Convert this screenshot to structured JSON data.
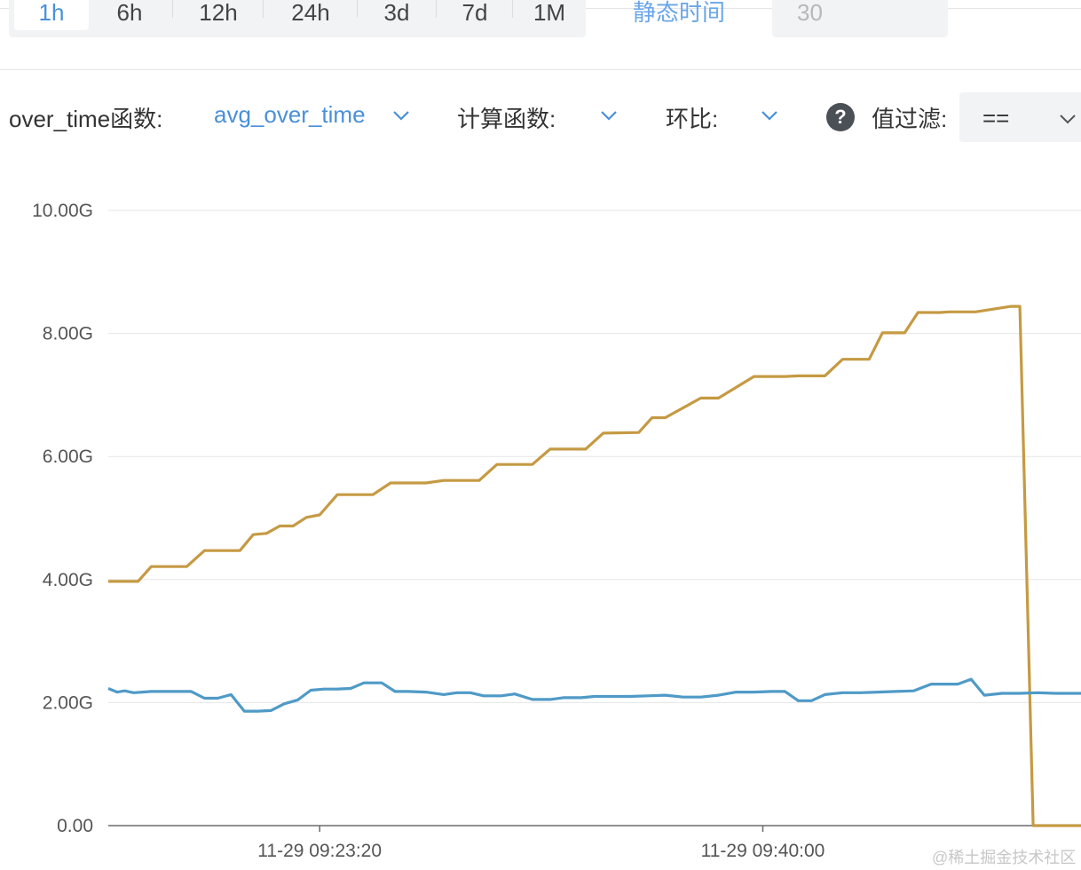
{
  "time_tabs": [
    {
      "label": "1h",
      "active": true
    },
    {
      "label": "6h",
      "active": false
    },
    {
      "label": "12h",
      "active": false
    },
    {
      "label": "24h",
      "active": false
    },
    {
      "label": "3d",
      "active": false
    },
    {
      "label": "7d",
      "active": false
    },
    {
      "label": "1M",
      "active": false
    }
  ],
  "static_time": {
    "label": "静态时间",
    "value": "30"
  },
  "filters": {
    "over_time_label": "over_time函数:",
    "over_time_value": "avg_over_time",
    "calc_label": "计算函数:",
    "ratio_label": "环比:",
    "help_icon": "question-circle-icon",
    "value_filter_label": "值过滤:",
    "value_filter_op": "=="
  },
  "colors": {
    "accent": "#4a90d9",
    "series_gold": "#c59a43",
    "series_blue": "#4f9ac7"
  },
  "watermark": "@稀土掘金技术社区",
  "chart_data": {
    "type": "line",
    "title": "",
    "xlabel": "",
    "ylabel": "",
    "yunit": "G",
    "ylim": [
      0,
      10
    ],
    "y_ticks": [
      {
        "value": 0,
        "label": "0.00"
      },
      {
        "value": 2,
        "label": "2.00G"
      },
      {
        "value": 4,
        "label": "4.00G"
      },
      {
        "value": 6,
        "label": "6.00G"
      },
      {
        "value": 8,
        "label": "8.00G"
      },
      {
        "value": 10,
        "label": "10.00G"
      }
    ],
    "x_range": [
      "11-29 09:15:23",
      "11-29 09:51:58"
    ],
    "x_ticks": [
      {
        "label": "11-29 09:23:20"
      },
      {
        "label": "11-29 09:40:00"
      }
    ],
    "grid": true,
    "legend": "none",
    "series": [
      {
        "color": "#c59a43",
        "x": [
          "09:15:23",
          "09:16:30",
          "09:17:00",
          "09:18:20",
          "09:19:00",
          "09:20:20",
          "09:20:50",
          "09:21:20",
          "09:21:50",
          "09:22:20",
          "09:22:50",
          "09:23:20",
          "09:24:00",
          "09:25:20",
          "09:26:00",
          "09:27:20",
          "09:28:00",
          "09:29:20",
          "09:30:00",
          "09:31:20",
          "09:32:00",
          "09:33:20",
          "09:34:00",
          "09:35:20",
          "09:35:50",
          "09:36:20",
          "09:37:40",
          "09:38:20",
          "09:39:40",
          "09:40:20",
          "09:40:50",
          "09:41:20",
          "09:42:20",
          "09:43:00",
          "09:44:00",
          "09:44:30",
          "09:45:20",
          "09:45:50",
          "09:46:40",
          "09:47:00",
          "09:48:00",
          "09:49:20",
          "09:49:40",
          "09:50:10",
          "09:50:40",
          "09:51:58"
        ],
        "y": [
          3.97,
          3.97,
          4.21,
          4.21,
          4.47,
          4.47,
          4.73,
          4.75,
          4.87,
          4.87,
          5.01,
          5.05,
          5.38,
          5.38,
          5.57,
          5.57,
          5.61,
          5.61,
          5.87,
          5.87,
          6.12,
          6.12,
          6.38,
          6.39,
          6.63,
          6.63,
          6.95,
          6.95,
          7.3,
          7.3,
          7.3,
          7.31,
          7.31,
          7.58,
          7.58,
          8.01,
          8.01,
          8.34,
          8.34,
          8.35,
          8.35,
          8.44,
          8.44,
          0.0,
          0.0,
          0.0
        ]
      },
      {
        "color": "#4f9ac7",
        "x": [
          "09:15:23",
          "09:15:43",
          "09:16:00",
          "09:16:20",
          "09:16:40",
          "09:17:00",
          "09:17:30",
          "09:18:00",
          "09:18:30",
          "09:19:00",
          "09:19:30",
          "09:20:00",
          "09:20:30",
          "09:21:00",
          "09:21:30",
          "09:22:00",
          "09:22:30",
          "09:23:00",
          "09:23:30",
          "09:24:00",
          "09:24:30",
          "09:25:00",
          "09:25:40",
          "09:26:10",
          "09:26:40",
          "09:27:20",
          "09:28:00",
          "09:28:30",
          "09:29:00",
          "09:29:30",
          "09:30:10",
          "09:30:40",
          "09:31:20",
          "09:32:00",
          "09:32:30",
          "09:33:10",
          "09:33:40",
          "09:34:20",
          "09:35:00",
          "09:35:40",
          "09:36:20",
          "09:37:00",
          "09:37:40",
          "09:38:20",
          "09:39:00",
          "09:39:40",
          "09:40:20",
          "09:40:50",
          "09:41:20",
          "09:41:50",
          "09:42:20",
          "09:43:00",
          "09:43:40",
          "09:44:20",
          "09:45:00",
          "09:45:40",
          "09:46:20",
          "09:46:50",
          "09:47:20",
          "09:47:50",
          "09:48:20",
          "09:49:00",
          "09:49:40",
          "09:50:20",
          "09:51:00",
          "09:51:58"
        ],
        "y": [
          2.23,
          2.17,
          2.19,
          2.16,
          2.17,
          2.18,
          2.18,
          2.18,
          2.18,
          2.07,
          2.07,
          2.13,
          1.86,
          1.86,
          1.87,
          1.98,
          2.04,
          2.2,
          2.22,
          2.22,
          2.23,
          2.32,
          2.32,
          2.18,
          2.18,
          2.17,
          2.13,
          2.16,
          2.16,
          2.11,
          2.11,
          2.14,
          2.05,
          2.05,
          2.08,
          2.08,
          2.1,
          2.1,
          2.1,
          2.11,
          2.12,
          2.09,
          2.09,
          2.12,
          2.17,
          2.17,
          2.18,
          2.18,
          2.03,
          2.03,
          2.13,
          2.16,
          2.16,
          2.17,
          2.18,
          2.19,
          2.3,
          2.3,
          2.3,
          2.38,
          2.12,
          2.15,
          2.15,
          2.16,
          2.15,
          2.15
        ]
      }
    ]
  }
}
